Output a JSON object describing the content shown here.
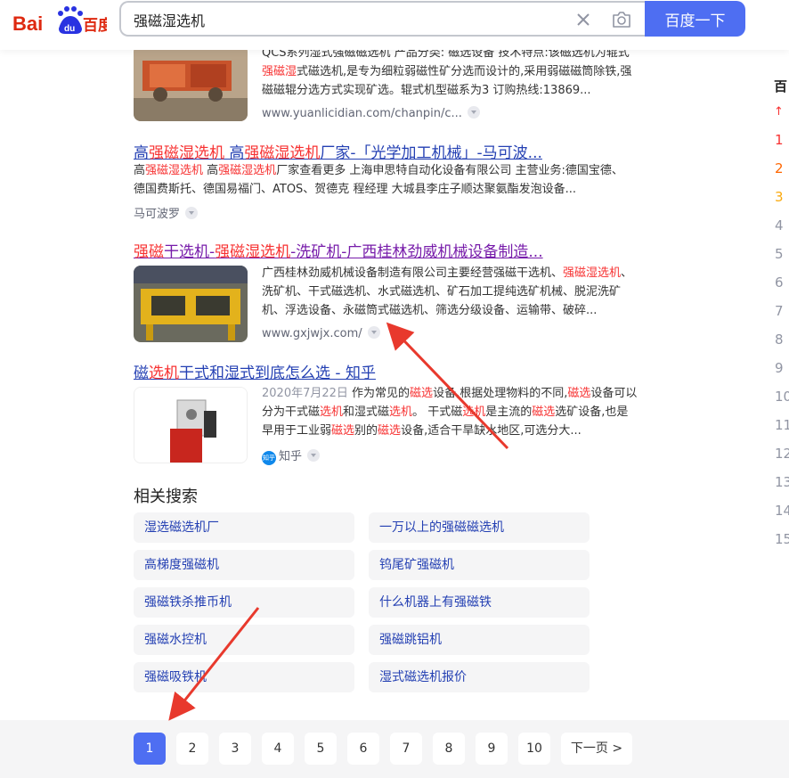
{
  "search": {
    "query": "强磁湿选机",
    "button_label": "百度一下"
  },
  "results": [
    {
      "desc_lines": [
        [
          {
            "t": "QCS系列湿式强磁磁选机 产品分类: 磁选设备 技术特点:该磁选机为辊式",
            "h": false
          }
        ],
        [
          {
            "t": "强磁湿",
            "h": true
          },
          {
            "t": "式磁选机,是专为细粒弱磁性矿分选而设计的,采用弱磁磁筒除铁,强",
            "h": false
          }
        ],
        [
          {
            "t": "磁磁辊分选方式实现矿选。辊式机型磁系为3 订购热线:13869...",
            "h": false
          }
        ]
      ],
      "url": "www.yuanlicidian.com/chanpin/c..."
    },
    {
      "title": [
        {
          "t": "高",
          "h": false
        },
        {
          "t": "强磁湿选机",
          "h": true
        },
        {
          "t": " 高",
          "h": false
        },
        {
          "t": "强磁湿选机",
          "h": true
        },
        {
          "t": "厂家-「光学加工机械」-马可波...",
          "h": false
        }
      ],
      "desc_lines": [
        [
          {
            "t": "高",
            "h": false
          },
          {
            "t": "强磁湿选机",
            "h": true
          },
          {
            "t": " 高",
            "h": false
          },
          {
            "t": "强磁湿选机",
            "h": true
          },
          {
            "t": "厂家查看更多 上海申思特自动化设备有限公司 主营业务:德国宝德、",
            "h": false
          }
        ],
        [
          {
            "t": "德国费斯托、德国易福门、ATOS、贺德克 程经理 大城县李庄子顺达聚氨酯发泡设备...",
            "h": false
          }
        ]
      ],
      "url": "马可波罗"
    },
    {
      "title": [
        {
          "t": "强磁",
          "h": true
        },
        {
          "t": "干选机-",
          "h": false
        },
        {
          "t": "强磁湿选机",
          "h": true
        },
        {
          "t": "-洗矿机-广西桂林劲威机械设备制造...",
          "h": false
        }
      ],
      "desc_lines": [
        [
          {
            "t": "广西桂林劲威机械设备制造有限公司主要经营强磁干选机、",
            "h": false
          },
          {
            "t": "强磁湿选机",
            "h": true
          },
          {
            "t": "、",
            "h": false
          }
        ],
        [
          {
            "t": "洗矿机、干式磁选机、水式磁选机、矿石加工提纯选矿机械、脱泥洗矿",
            "h": false
          }
        ],
        [
          {
            "t": "机、浮选设备、永磁筒式磁选机、筛选分级设备、运输带、破碎...",
            "h": false
          }
        ]
      ],
      "url": "www.gxjwjx.com/"
    },
    {
      "title": [
        {
          "t": "磁",
          "h": false
        },
        {
          "t": "选机",
          "h": true
        },
        {
          "t": "干式和湿式到底怎么选 - 知乎",
          "h": false
        }
      ],
      "date": "2020年7月22日",
      "desc_lines": [
        [
          {
            "t": " 作为常见的",
            "h": false
          },
          {
            "t": "磁选",
            "h": true
          },
          {
            "t": "设备,根据处理物料的不同,",
            "h": false
          },
          {
            "t": "磁选",
            "h": true
          },
          {
            "t": "设备可以",
            "h": false
          }
        ],
        [
          {
            "t": "分为干式磁",
            "h": false
          },
          {
            "t": "选机",
            "h": true
          },
          {
            "t": "和湿式磁",
            "h": false
          },
          {
            "t": "选机",
            "h": true
          },
          {
            "t": "。 干式磁",
            "h": false
          },
          {
            "t": "选机",
            "h": true
          },
          {
            "t": "是主流的",
            "h": false
          },
          {
            "t": "磁选",
            "h": true
          },
          {
            "t": "选矿设备,也是",
            "h": false
          }
        ],
        [
          {
            "t": "早用于工业弱",
            "h": false
          },
          {
            "t": "磁选",
            "h": true
          },
          {
            "t": "别的",
            "h": false
          },
          {
            "t": "磁选",
            "h": true
          },
          {
            "t": "设备,适合干旱缺水地区,可选分大...",
            "h": false
          }
        ]
      ],
      "source": "知乎",
      "badge_text": "知乎"
    }
  ],
  "related": {
    "title": "相关搜索",
    "items": [
      "湿选磁选机厂",
      "一万以上的强磁磁选机",
      "高梯度强磁机",
      "钨尾矿强磁机",
      "强磁铁杀推币机",
      "什么机器上有强磁铁",
      "强磁水控机",
      "强磁跳铝机",
      "强磁吸铁机",
      "湿式磁选机报价"
    ]
  },
  "right_panel": {
    "heading": "百",
    "ranks": [
      "1",
      "2",
      "3",
      "4",
      "5",
      "6",
      "7",
      "8",
      "9",
      "10",
      "11",
      "12",
      "13",
      "14",
      "15"
    ]
  },
  "pagination": {
    "pages": [
      "1",
      "2",
      "3",
      "4",
      "5",
      "6",
      "7",
      "8",
      "9",
      "10"
    ],
    "current": "1",
    "next_label": "下一页 >"
  },
  "colors": {
    "accent": "#4e6ef2",
    "link": "#2440b3",
    "highlight": "#f73131",
    "visited": "#771caa",
    "logo_red": "#de2910",
    "annotation_arrow": "#e8392d"
  }
}
